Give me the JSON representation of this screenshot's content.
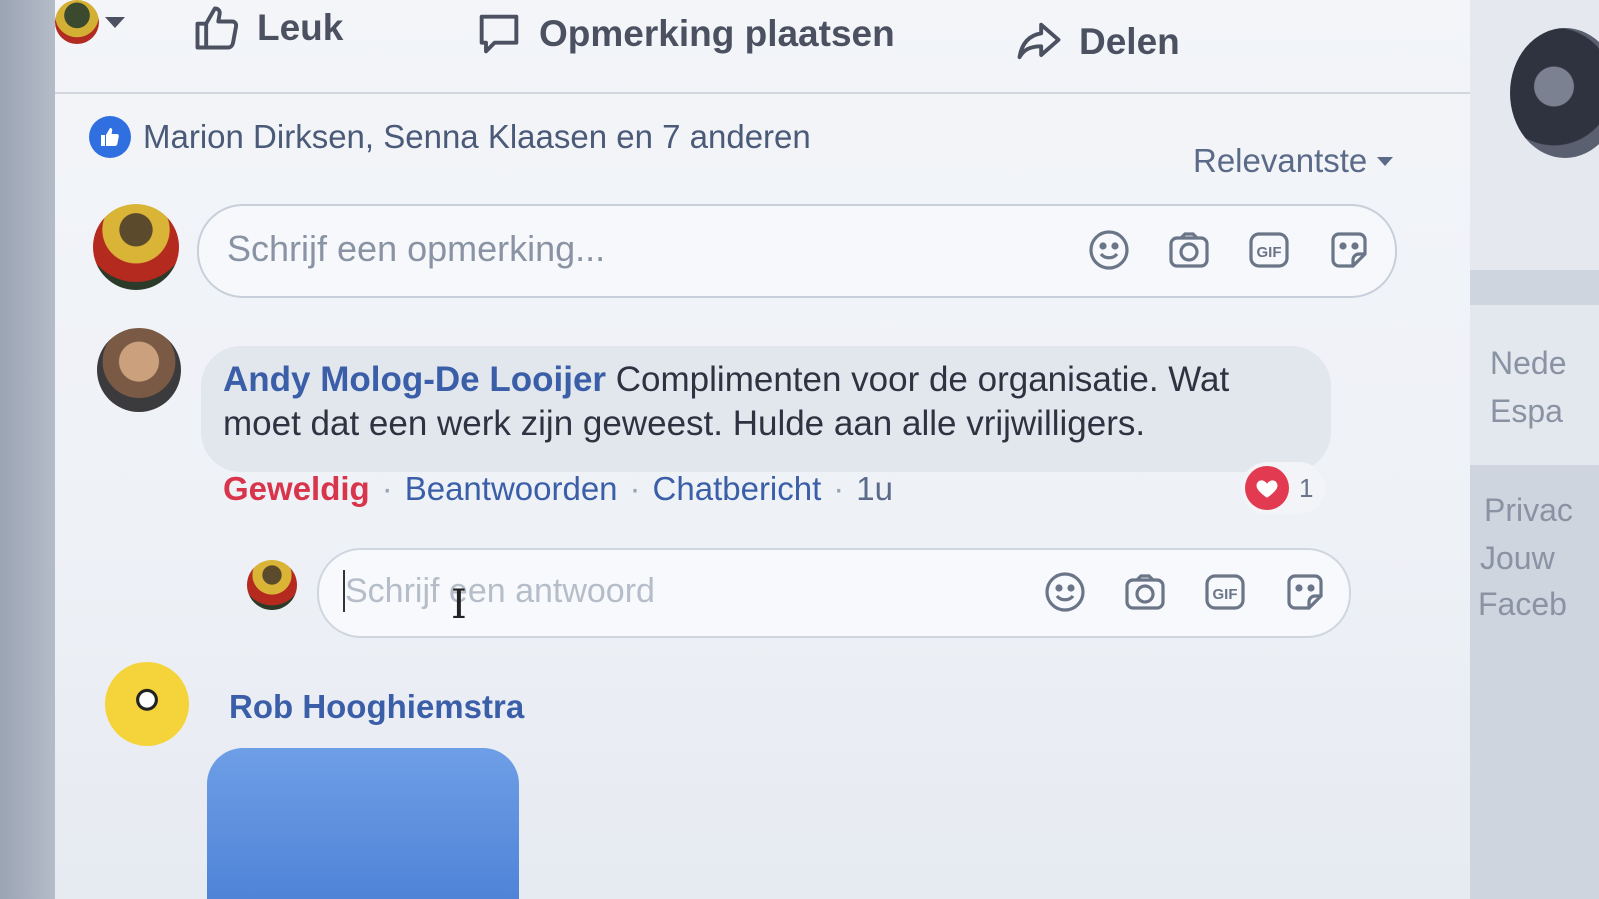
{
  "actions": {
    "like": "Leuk",
    "comment": "Opmerking plaatsen",
    "share": "Delen"
  },
  "likes_summary": "Marion Dirksen, Senna Klaasen en 7 anderen",
  "sort_label": "Relevantste",
  "comment_input": {
    "placeholder": "Schrijf een opmerking..."
  },
  "comments": [
    {
      "author": "Andy Molog-De Looijer",
      "text": "Complimenten voor de organisatie. Wat moet dat een werk zijn geweest. Hulde aan alle vrijwilligers.",
      "reaction_label": "Geweldig",
      "reply_label": "Beantwoorden",
      "message_label": "Chatbericht",
      "time": "1u",
      "reaction_count": "1"
    },
    {
      "author": "Rob Hooghiemstra"
    }
  ],
  "reply_input": {
    "placeholder": "Schrijf een antwoord"
  },
  "right_column": [
    "Nede",
    "Espa",
    "Privac",
    "Jouw",
    "Faceb"
  ],
  "icons": {
    "like": "thumbs-up-icon",
    "comment": "speech-bubble-icon",
    "share": "share-arrow-icon",
    "emoji": "smiley-icon",
    "camera": "camera-icon",
    "gif": "gif-icon",
    "sticker": "sticker-icon",
    "heart": "heart-icon"
  },
  "colors": {
    "link_blue": "#3a5ea8",
    "like_blue": "#2f6fe0",
    "love_red": "#d8344c"
  }
}
